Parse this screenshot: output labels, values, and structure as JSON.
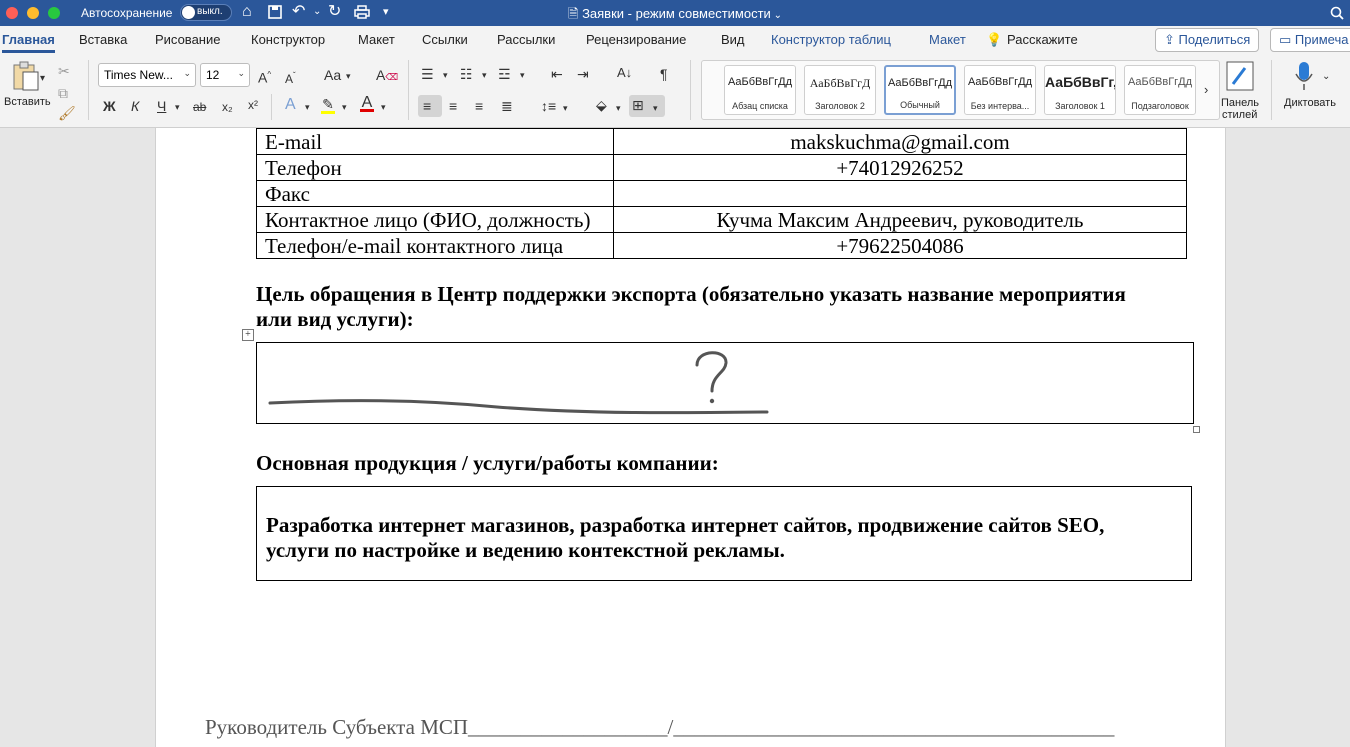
{
  "titlebar": {
    "autosave_label": "Автосохранение",
    "autosave_state": "выкл.",
    "doc_title": "Заявки  -  режим совместимости",
    "icons": [
      "home-icon",
      "save-icon",
      "undo-icon",
      "redo-icon",
      "print-icon",
      "customize-icon",
      "search-icon"
    ]
  },
  "tabs": {
    "items": [
      "Главная",
      "Вставка",
      "Рисование",
      "Конструктор",
      "Макет",
      "Ссылки",
      "Рассылки",
      "Рецензирование",
      "Вид",
      "Конструктор таблиц",
      "Макет",
      "Расскажите"
    ],
    "active": "Главная",
    "share_label": "Поделиться",
    "comments_label": "Примеча"
  },
  "ribbon": {
    "paste_label": "Вставить",
    "font_name": "Times New...",
    "font_size": "12",
    "bold": "Ж",
    "italic": "К",
    "underline": "Ч",
    "strike": "ab",
    "subscript": "x₂",
    "superscript": "x²",
    "styles": [
      {
        "sample": "АаБбВвГгДд",
        "name": "Абзац списка"
      },
      {
        "sample": "АаБбВвГгД",
        "name": "Заголовок 2"
      },
      {
        "sample": "АаБбВвГгДд",
        "name": "Обычный",
        "selected": true
      },
      {
        "sample": "АаБбВвГгДд",
        "name": "Без интерва..."
      },
      {
        "sample": "АаБбВвГг,",
        "name": "Заголовок 1"
      },
      {
        "sample": "АаБбВвГгДд",
        "name": "Подзаголовок"
      }
    ],
    "styles_pane_label_1": "Панель",
    "styles_pane_label_2": "стилей",
    "dictate_label": "Диктовать",
    "colors": {
      "accent": "#2b579a",
      "highlight": "#ffff00",
      "font_color": "#e00000"
    }
  },
  "document": {
    "contacts": [
      {
        "label": "E-mail",
        "value": "makskuchma@gmail.com"
      },
      {
        "label": "Телефон",
        "value": "+74012926252"
      },
      {
        "label": "Факс",
        "value": ""
      },
      {
        "label": "Контактное лицо (ФИО, должность)",
        "value": "Кучма Максим Андреевич, руководитель"
      },
      {
        "label": "Телефон/e-mail контактного лица",
        "value": "+79622504086"
      }
    ],
    "purpose_heading_line1": "Цель обращения в Центр поддержки экспорта (обязательно указать название мероприятия",
    "purpose_heading_line2": "или вид услуги):",
    "products_heading": "Основная продукция / услуги/работы компании:",
    "products_line1": "Разработка интернет магазинов, разработка интернет сайтов, продвижение сайтов SEO,",
    "products_line2": "услуги по настройке и ведению контекстной рекламы.",
    "signature_line": "Руководитель Субъекта МСП___________________/__________________________________________"
  }
}
